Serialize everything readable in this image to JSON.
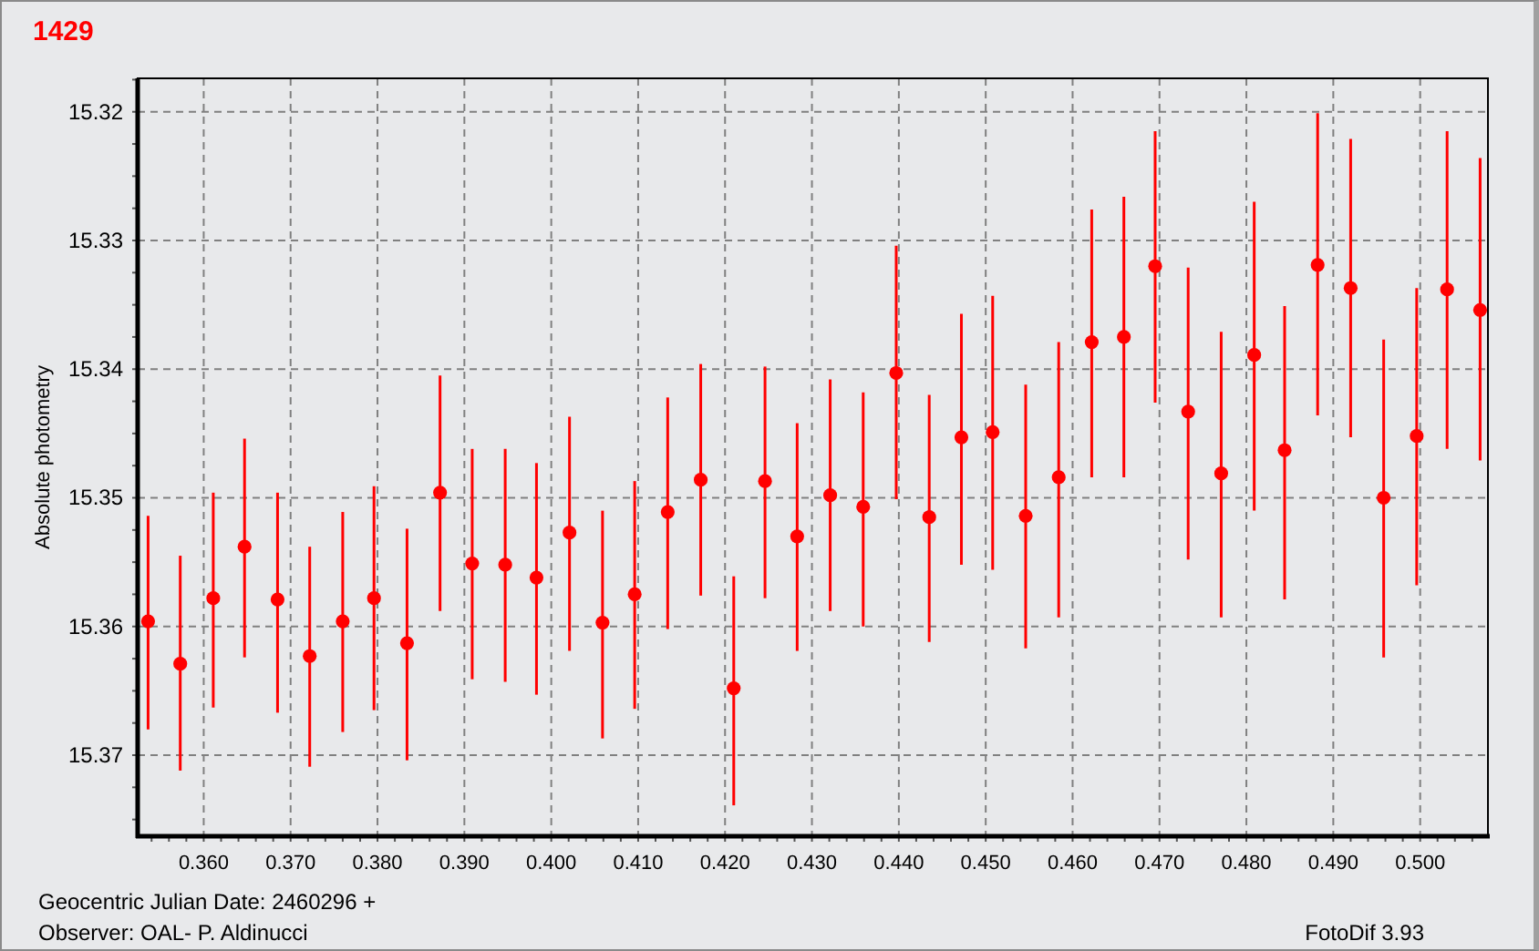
{
  "title": "1429",
  "chart": {
    "chart_data": {
      "type": "scatter",
      "xlabel": "Geocentric Julian Date: 2460296 +",
      "ylabel": "Absolute photometry",
      "xlim": [
        0.3524,
        0.5078
      ],
      "ylim": [
        15.3763,
        15.3174
      ],
      "xticks": [
        {
          "value": 0.36,
          "label": "0.360"
        },
        {
          "value": 0.37,
          "label": "0.370"
        },
        {
          "value": 0.38,
          "label": "0.380"
        },
        {
          "value": 0.39,
          "label": "0.390"
        },
        {
          "value": 0.4,
          "label": "0.400"
        },
        {
          "value": 0.41,
          "label": "0.410"
        },
        {
          "value": 0.42,
          "label": "0.420"
        },
        {
          "value": 0.43,
          "label": "0.430"
        },
        {
          "value": 0.44,
          "label": "0.440"
        },
        {
          "value": 0.45,
          "label": "0.450"
        },
        {
          "value": 0.46,
          "label": "0.460"
        },
        {
          "value": 0.47,
          "label": "0.470"
        },
        {
          "value": 0.48,
          "label": "0.480"
        },
        {
          "value": 0.49,
          "label": "0.490"
        },
        {
          "value": 0.5,
          "label": "0.500"
        }
      ],
      "yticks": [
        15.32,
        15.33,
        15.34,
        15.35,
        15.36,
        15.37
      ],
      "x": [
        0.3536,
        0.3573,
        0.3611,
        0.3647,
        0.3685,
        0.3722,
        0.376,
        0.3796,
        0.3834,
        0.3872,
        0.3909,
        0.3947,
        0.3983,
        0.4021,
        0.4059,
        0.4096,
        0.4134,
        0.4172,
        0.421,
        0.4246,
        0.4283,
        0.4321,
        0.4359,
        0.4397,
        0.4435,
        0.4472,
        0.4508,
        0.4546,
        0.4584,
        0.4622,
        0.4659,
        0.4695,
        0.4733,
        0.4771,
        0.4809,
        0.4844,
        0.4882,
        0.492,
        0.4958,
        0.4996,
        0.5031,
        0.5069
      ],
      "series": [
        {
          "color": "#ff0000",
          "values": [
            15.3596,
            15.3629,
            15.3578,
            15.3538,
            15.3579,
            15.3623,
            15.3596,
            15.3578,
            15.3613,
            15.3496,
            15.3551,
            15.3552,
            15.3562,
            15.3527,
            15.3597,
            15.3575,
            15.3511,
            15.3486,
            15.3648,
            15.3487,
            15.353,
            15.3498,
            15.3507,
            15.3403,
            15.3515,
            15.3453,
            15.3449,
            15.3514,
            15.3484,
            15.3379,
            15.3375,
            15.332,
            15.3433,
            15.3481,
            15.3389,
            15.3463,
            15.3319,
            15.3337,
            15.35,
            15.3452,
            15.3338,
            15.3354
          ],
          "errors": [
            [
              15.3514,
              15.368
            ],
            [
              15.3545,
              15.3712
            ],
            [
              15.3496,
              15.3663
            ],
            [
              15.3454,
              15.3624
            ],
            [
              15.3496,
              15.3667
            ],
            [
              15.3538,
              15.3709
            ],
            [
              15.3511,
              15.3682
            ],
            [
              15.3491,
              15.3665
            ],
            [
              15.3524,
              15.3704
            ],
            [
              15.3405,
              15.3588
            ],
            [
              15.3462,
              15.3641
            ],
            [
              15.3462,
              15.3643
            ],
            [
              15.3473,
              15.3653
            ],
            [
              15.3437,
              15.3619
            ],
            [
              15.351,
              15.3687
            ],
            [
              15.3487,
              15.3664
            ],
            [
              15.3422,
              15.3602
            ],
            [
              15.3396,
              15.3576
            ],
            [
              15.3561,
              15.3739
            ],
            [
              15.3398,
              15.3578
            ],
            [
              15.3442,
              15.3619
            ],
            [
              15.3408,
              15.3588
            ],
            [
              15.3418,
              15.36
            ],
            [
              15.3304,
              15.3501
            ],
            [
              15.342,
              15.3612
            ],
            [
              15.3357,
              15.3552
            ],
            [
              15.3343,
              15.3556
            ],
            [
              15.3412,
              15.3617
            ],
            [
              15.3379,
              15.3593
            ],
            [
              15.3276,
              15.3484
            ],
            [
              15.3266,
              15.3484
            ],
            [
              15.3215,
              15.3426
            ],
            [
              15.3321,
              15.3548
            ],
            [
              15.3371,
              15.3593
            ],
            [
              15.327,
              15.351
            ],
            [
              15.3351,
              15.3579
            ],
            [
              15.3201,
              15.3436
            ],
            [
              15.3221,
              15.3453
            ],
            [
              15.3377,
              15.3624
            ],
            [
              15.3337,
              15.3568
            ],
            [
              15.3215,
              15.3462
            ],
            [
              15.3236,
              15.3471
            ]
          ]
        }
      ],
      "grid": true
    }
  },
  "footer": {
    "observer": "Observer: OAL- P. Aldinucci",
    "software": "FotoDif 3.93"
  }
}
